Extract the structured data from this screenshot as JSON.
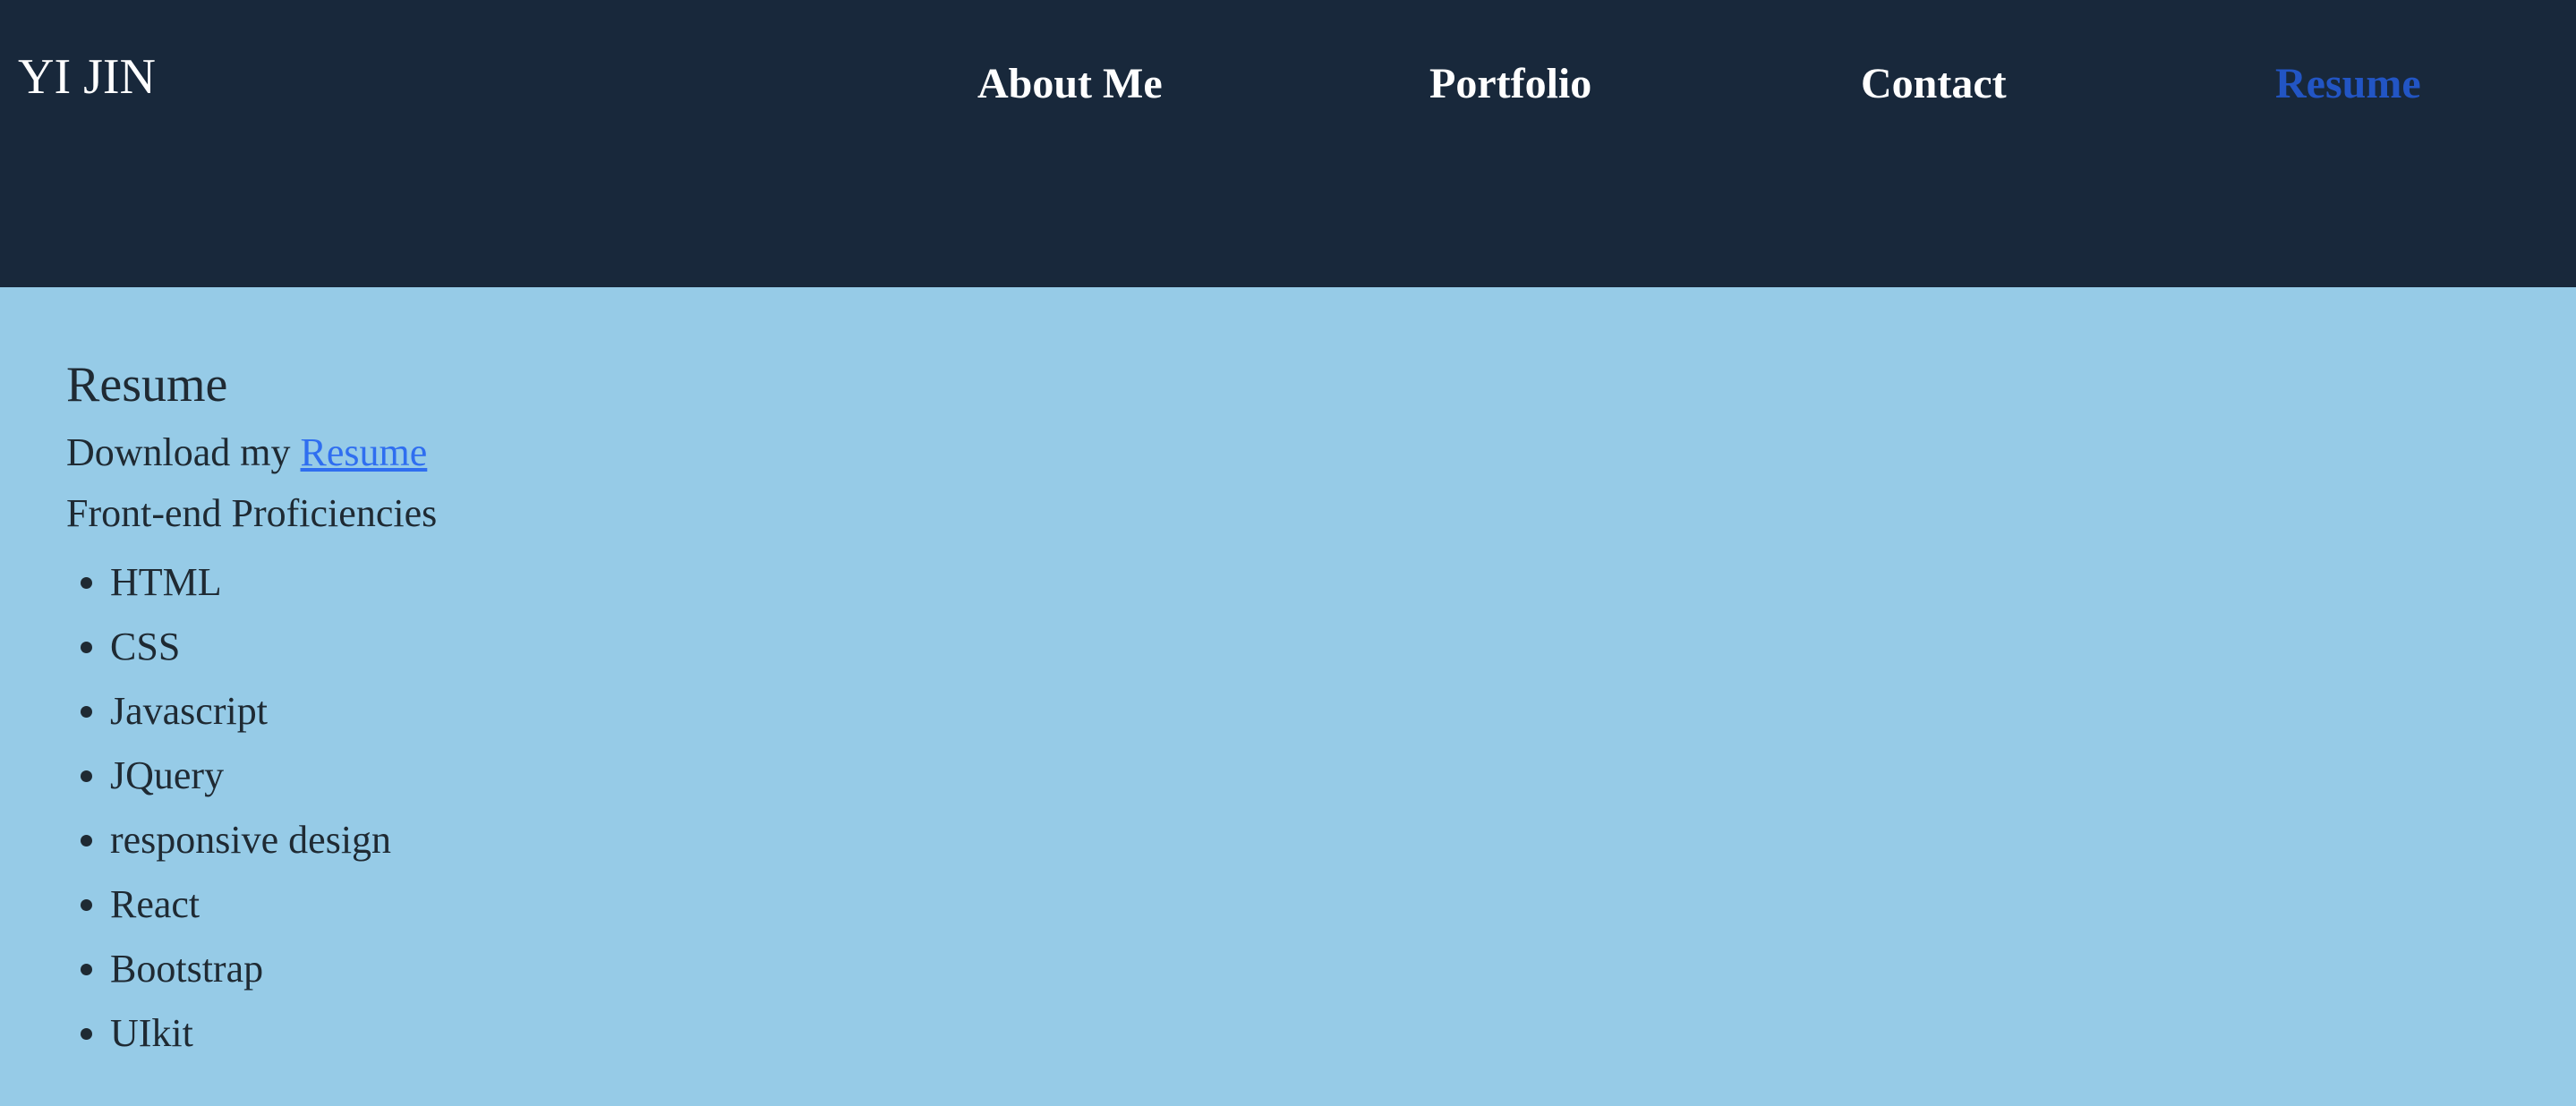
{
  "header": {
    "logo": "YI JIN",
    "nav": [
      {
        "label": "About Me",
        "active": false
      },
      {
        "label": "Portfolio",
        "active": false
      },
      {
        "label": "Contact",
        "active": false
      },
      {
        "label": "Resume",
        "active": true
      }
    ]
  },
  "main": {
    "title": "Resume",
    "download_prefix": "Download my",
    "download_link": "Resume",
    "skills_heading": "Front-end Proficiencies",
    "skills": [
      "HTML",
      "CSS",
      "Javascript",
      "JQuery",
      "responsive design",
      "React",
      "Bootstrap",
      "UIkit"
    ]
  },
  "colors": {
    "header_bg": "#18283b",
    "page_bg": "#96cbe7",
    "active_nav": "#2255c4",
    "link": "#2f6ef0"
  }
}
